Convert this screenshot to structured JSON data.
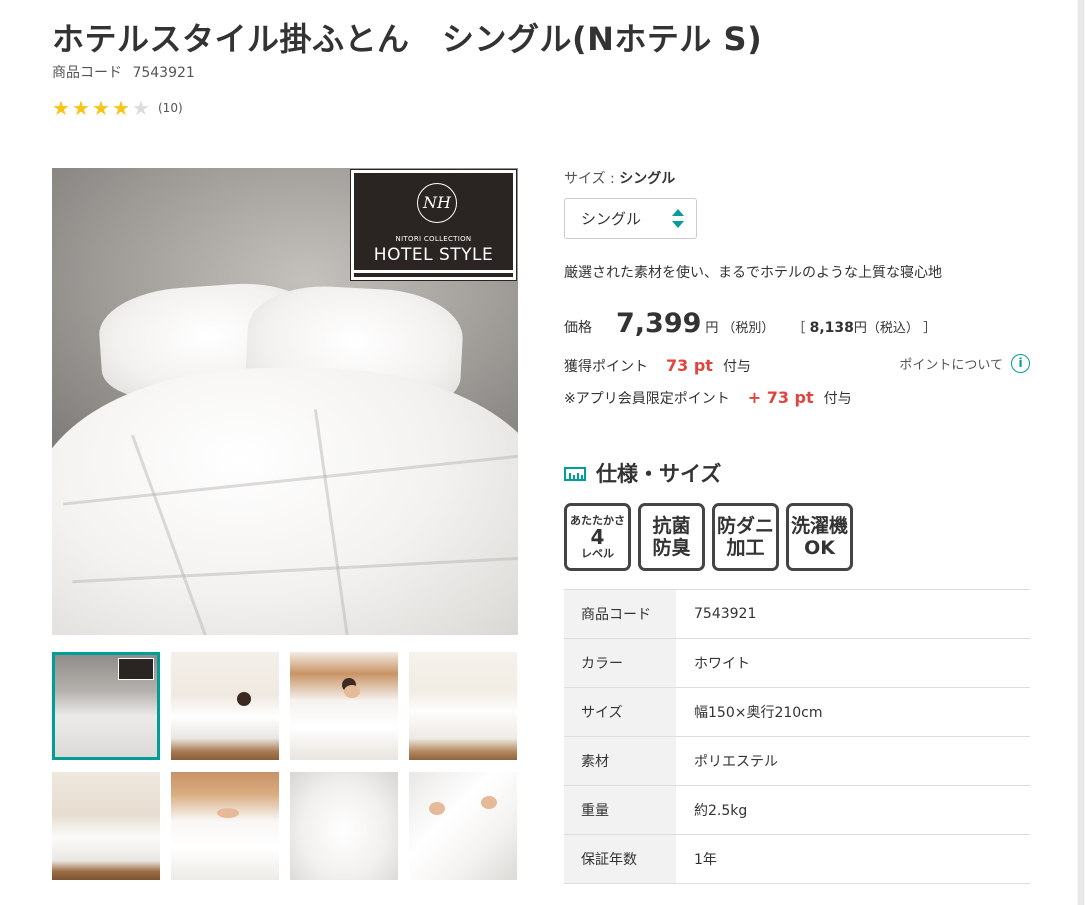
{
  "product": {
    "title": "ホテルスタイル掛ふとん　シングル(Nホテル S)",
    "code_label": "商品コード",
    "code": "7543921",
    "rating": 4,
    "rating_max": 5,
    "review_count": "(10)"
  },
  "image_badge": {
    "monogram": "NH",
    "collection": "NITORI COLLECTION",
    "brand": "HOTEL STYLE"
  },
  "thumbnails": [
    {
      "label": "thumbnail-1"
    },
    {
      "label": "thumbnail-2"
    },
    {
      "label": "thumbnail-3"
    },
    {
      "label": "thumbnail-4"
    },
    {
      "label": "thumbnail-5"
    },
    {
      "label": "thumbnail-6"
    },
    {
      "label": "thumbnail-7"
    },
    {
      "label": "thumbnail-8"
    }
  ],
  "size": {
    "label": "サイズ : ",
    "selected": "シングル"
  },
  "description": "厳選された素材を使い、まるでホテルのような上質な寝心地",
  "price": {
    "label": "価格",
    "value": "7,399",
    "unit": "円",
    "tax_note": "（税別）",
    "incl_open": "［",
    "incl_value": "8,138",
    "incl_unit": "円",
    "incl_note": "（税込）",
    "incl_close": "］"
  },
  "points": {
    "label": "獲得ポイント",
    "value": "73 pt",
    "suffix": "付与",
    "about": "ポイントについて",
    "app_label": "※アプリ会員限定ポイント",
    "app_value": "+ 73 pt",
    "app_suffix": "付与"
  },
  "spec": {
    "title": "仕様・サイズ",
    "features": [
      {
        "line1": "あたたかさ",
        "line2": "4",
        "line3": "レベル"
      },
      {
        "line1": "抗菌",
        "line2": "防臭"
      },
      {
        "line1": "防ダニ",
        "line2": "加工"
      },
      {
        "line1": "洗濯機",
        "line2": "OK"
      }
    ],
    "rows": [
      {
        "key": "商品コード",
        "value": "7543921"
      },
      {
        "key": "カラー",
        "value": "ホワイト"
      },
      {
        "key": "サイズ",
        "value": "幅150×奥行210cm"
      },
      {
        "key": "素材",
        "value": "ポリエステル"
      },
      {
        "key": "重量",
        "value": "約2.5kg"
      },
      {
        "key": "保証年数",
        "value": "1年"
      }
    ]
  },
  "colors": {
    "accent": "#009e96",
    "point_red": "#e0443e",
    "star": "#f5c518"
  }
}
